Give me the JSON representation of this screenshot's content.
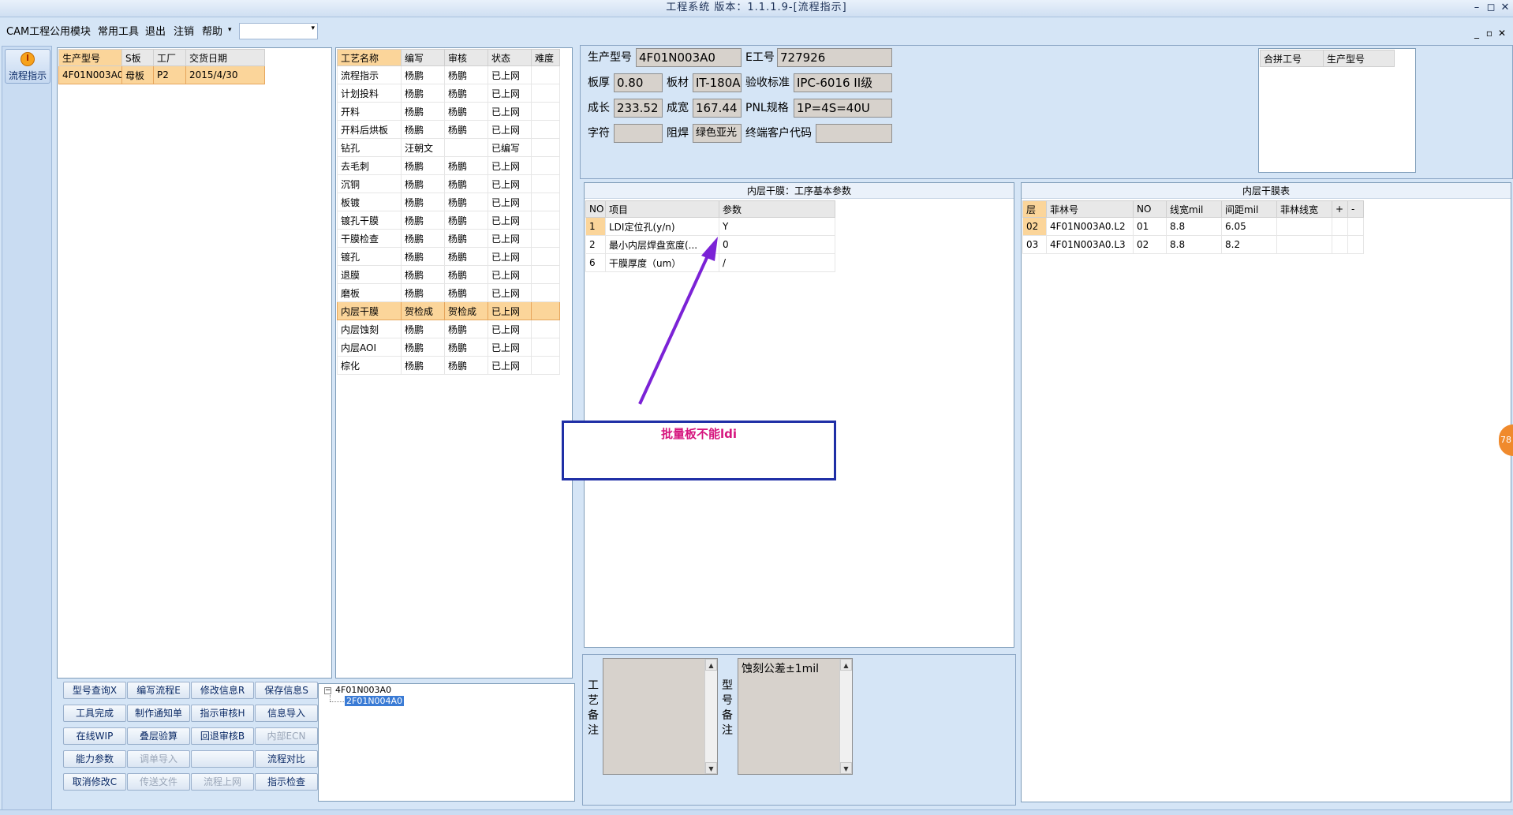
{
  "window": {
    "title": "工程系统 版本：1.1.1.9-[流程指示]"
  },
  "menu": {
    "items": [
      "CAM工程",
      "公用模块",
      "常用工具",
      "退出",
      "注销",
      "帮助"
    ],
    "combo_value": ""
  },
  "sidebar": {
    "button_label": "流程指示"
  },
  "model_table": {
    "headers": [
      "生产型号",
      "S板",
      "工厂",
      "交货日期"
    ],
    "rows": [
      [
        "4F01N003A0",
        "母板",
        "P2",
        "2015/4/30"
      ]
    ]
  },
  "process_table": {
    "headers": [
      "工艺名称",
      "编写",
      "审核",
      "状态",
      "难度"
    ],
    "rows": [
      [
        "流程指示",
        "杨鹏",
        "杨鹏",
        "已上网",
        ""
      ],
      [
        "计划投料",
        "杨鹏",
        "杨鹏",
        "已上网",
        ""
      ],
      [
        "开料",
        "杨鹏",
        "杨鹏",
        "已上网",
        ""
      ],
      [
        "开料后烘板",
        "杨鹏",
        "杨鹏",
        "已上网",
        ""
      ],
      [
        "钻孔",
        "汪朝文",
        "",
        "已编写",
        ""
      ],
      [
        "去毛刺",
        "杨鹏",
        "杨鹏",
        "已上网",
        ""
      ],
      [
        "沉铜",
        "杨鹏",
        "杨鹏",
        "已上网",
        ""
      ],
      [
        "板镀",
        "杨鹏",
        "杨鹏",
        "已上网",
        ""
      ],
      [
        "镀孔干膜",
        "杨鹏",
        "杨鹏",
        "已上网",
        ""
      ],
      [
        "干膜检查",
        "杨鹏",
        "杨鹏",
        "已上网",
        ""
      ],
      [
        "镀孔",
        "杨鹏",
        "杨鹏",
        "已上网",
        ""
      ],
      [
        "退膜",
        "杨鹏",
        "杨鹏",
        "已上网",
        ""
      ],
      [
        "磨板",
        "杨鹏",
        "杨鹏",
        "已上网",
        ""
      ],
      [
        "内层干膜",
        "贺检成",
        "贺检成",
        "已上网",
        ""
      ],
      [
        "内层蚀刻",
        "杨鹏",
        "杨鹏",
        "已上网",
        ""
      ],
      [
        "内层AOI",
        "杨鹏",
        "杨鹏",
        "已上网",
        ""
      ],
      [
        "棕化",
        "杨鹏",
        "杨鹏",
        "已上网",
        ""
      ]
    ],
    "selected_index": 13
  },
  "buttons": [
    [
      "型号查询X",
      "编写流程E",
      "修改信息R",
      "保存信息S"
    ],
    [
      "工具完成",
      "制作通知单",
      "指示审核H",
      "信息导入"
    ],
    [
      "在线WIP",
      "叠层验算",
      "回退审核B",
      "内部ECN"
    ],
    [
      "能力参数",
      "调单导入",
      "",
      "流程对比"
    ],
    [
      "取消修改C",
      "传送文件",
      "流程上网",
      "指示检查"
    ]
  ],
  "disabled_buttons": [
    "调单导入",
    "传送文件",
    "流程上网",
    "内部ECN"
  ],
  "tree": {
    "root": "4F01N003A0",
    "child": "2F01N004A0"
  },
  "info": {
    "model_label": "生产型号",
    "model_value": "4F01N003A0",
    "e_label": "E工号",
    "e_value": "727926",
    "thick_label": "板厚",
    "thick_value": "0.80",
    "material_label": "板材",
    "material_value": "IT-180A",
    "std_label": "验收标准",
    "std_value": "IPC-6016 II级",
    "len_label": "成长",
    "len_value": "233.52",
    "wid_label": "成宽",
    "wid_value": "167.44",
    "pnl_label": "PNL规格",
    "pnl_value": "1P=4S=40U",
    "char_label": "字符",
    "char_value": "",
    "mask_label": "阻焊",
    "mask_value": "绿色亚光",
    "cust_label": "终端客户代码",
    "cust_value": ""
  },
  "merge_table": {
    "headers": [
      "合拼工号",
      "生产型号"
    ]
  },
  "inner_params": {
    "title": "内层干膜：工序基本参数",
    "headers": [
      "NO",
      "项目",
      "参数"
    ],
    "rows": [
      [
        "1",
        "LDI定位孔(y/n)",
        "Y"
      ],
      [
        "2",
        "最小内层焊盘宽度(...",
        "0"
      ],
      [
        "6",
        "干膜厚度（um）",
        "/"
      ]
    ]
  },
  "inner_film": {
    "title": "内层干膜表",
    "headers": [
      "层",
      "菲林号",
      "NO",
      "线宽mil",
      "间距mil",
      "菲林线宽",
      "+",
      "-"
    ],
    "rows": [
      [
        "02",
        "4F01N003A0.L2",
        "01",
        "8.8",
        "6.05",
        ""
      ],
      [
        "03",
        "4F01N003A0.L3",
        "02",
        "8.8",
        "8.2",
        ""
      ]
    ]
  },
  "annotation": {
    "text": "批量板不能ldi",
    "arrow_color": "#7b22d6",
    "text_color": "#d6157e"
  },
  "remarks": {
    "process_label": "工艺备注",
    "process_text": "",
    "model_label": "型号备注",
    "model_text": "蚀刻公差±1mil"
  },
  "floating_badge": "78",
  "colors": {
    "selection": "#fbd59a",
    "window_bg": "#d5e5f6",
    "field_bg": "#d7d2cc"
  }
}
